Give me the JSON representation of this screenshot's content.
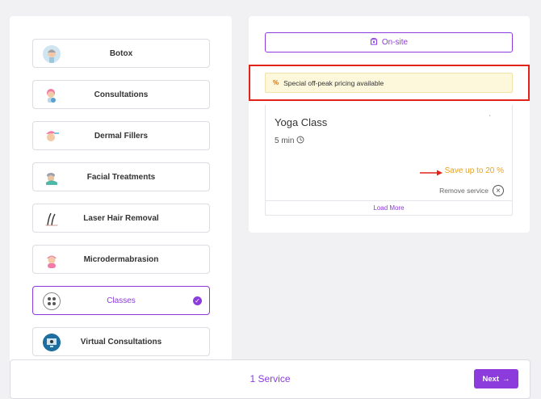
{
  "categories": [
    {
      "label": "Botox",
      "icon": "face-avatar-icon",
      "selected": false
    },
    {
      "label": "Consultations",
      "icon": "consultation-avatar-icon",
      "selected": false
    },
    {
      "label": "Dermal Fillers",
      "icon": "fillers-avatar-icon",
      "selected": false
    },
    {
      "label": "Facial Treatments",
      "icon": "facial-avatar-icon",
      "selected": false
    },
    {
      "label": "Laser Hair Removal",
      "icon": "hair-icon",
      "selected": false
    },
    {
      "label": "Microdermabrasion",
      "icon": "micro-avatar-icon",
      "selected": false
    },
    {
      "label": "Classes",
      "icon": "classes-icon",
      "selected": true
    },
    {
      "label": "Virtual Consultations",
      "icon": "monitor-icon",
      "selected": false
    }
  ],
  "location": {
    "label": "On-site"
  },
  "offpeak": {
    "symbol": "%",
    "text": "Special off-peak pricing available"
  },
  "service": {
    "name": "Yoga Class",
    "duration": "5 min",
    "save_text": "Save up to 20 %",
    "remove_label": "Remove service"
  },
  "load_more": "Load More",
  "footer": {
    "count": "1 Service",
    "next_label": "Next"
  },
  "colors": {
    "accent": "#8c3cdc",
    "highlight": "#e2231a",
    "save": "#e8a21d",
    "offpeak_bg": "#fdf7dc"
  }
}
